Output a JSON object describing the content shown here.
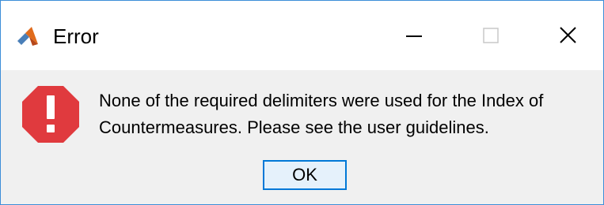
{
  "window": {
    "title": "Error",
    "app_icon": "matlab-icon",
    "controls": {
      "minimize_icon": "minimize-icon",
      "maximize_icon": "maximize-icon",
      "close_icon": "close-icon"
    }
  },
  "dialog": {
    "icon": "error-icon",
    "message_line1": "None of the required delimiters were used for the Index of",
    "message_line2": "Countermeasures. Please see the user guidelines.",
    "ok_label": "OK"
  },
  "colors": {
    "window_border": "#3c8ed8",
    "error_red": "#e03a3e",
    "button_border": "#0078d7",
    "button_bg": "#e5f1fb",
    "content_bg": "#f0f0f0"
  }
}
